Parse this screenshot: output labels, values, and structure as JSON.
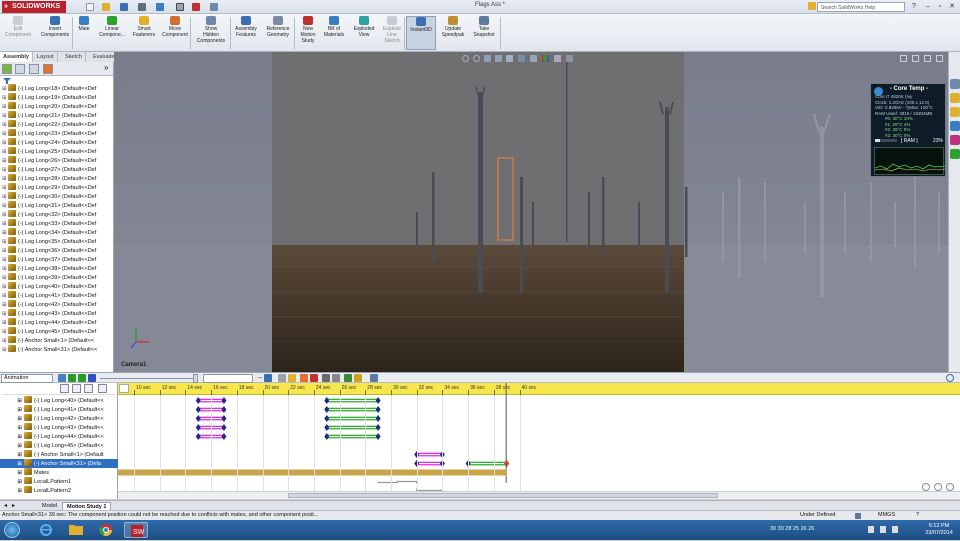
{
  "window": {
    "app_name": "SOLIDWORKS",
    "document_title": "Flags Ass *",
    "help_search_placeholder": "Search SolidWorks Help"
  },
  "ribbon": {
    "items": [
      {
        "label": "Edit\nComponent",
        "disabled": true
      },
      {
        "label": "Insert\nComponents",
        "disabled": false
      },
      {
        "label": "Mate",
        "disabled": false
      },
      {
        "label": "Linear\nCompone...",
        "disabled": false
      },
      {
        "label": "Smart\nFasteners",
        "disabled": false
      },
      {
        "label": "Move\nComponent",
        "disabled": false
      },
      {
        "label": "Show\nHidden\nComponents",
        "disabled": false
      },
      {
        "label": "Assembly\nFeatures",
        "disabled": false
      },
      {
        "label": "Reference\nGeometry",
        "disabled": false
      },
      {
        "label": "New\nMotion\nStudy",
        "disabled": false
      },
      {
        "label": "Bill of\nMaterials",
        "disabled": false
      },
      {
        "label": "Exploded\nView",
        "disabled": false
      },
      {
        "label": "Explode\nLine\nSketch",
        "disabled": true
      },
      {
        "label": "Instant3D",
        "disabled": false
      },
      {
        "label": "Update\nSpeedpak",
        "disabled": false
      },
      {
        "label": "Take\nSnapshot",
        "disabled": false
      }
    ]
  },
  "command_tabs": [
    "Assembly",
    "Layout",
    "Sketch",
    "Evaluate",
    "Render Tools",
    "Office Products"
  ],
  "feature_tree": {
    "rows": [
      "(-) Leg Long<18> (Default<<Def",
      "(-) Leg Long<19> (Default<<Def",
      "(-) Leg Long<20> (Default<<Def",
      "(-) Leg Long<21> (Default<<Def",
      "(-) Leg Long<22> (Default<<Def",
      "(-) Leg Long<23> (Default<<Def",
      "(-) Leg Long<24> (Default<<Def",
      "(-) Leg Long<25> (Default<<Def",
      "(-) Leg Long<26> (Default<<Def",
      "(-) Leg Long<27> (Default<<Def",
      "(-) Leg Long<28> (Default<<Def",
      "(-) Leg Long<29> (Default<<Def",
      "(-) Leg Long<30> (Default<<Def",
      "(-) Leg Long<31> (Default<<Def",
      "(-) Leg Long<32> (Default<<Def",
      "(-) Leg Long<33> (Default<<Def",
      "(-) Leg Long<34> (Default<<Def",
      "(-) Leg Long<35> (Default<<Def",
      "(-) Leg Long<36> (Default<<Def",
      "(-) Leg Long<37> (Default<<Def",
      "(-) Leg Long<38> (Default<<Def",
      "(-) Leg Long<39> (Default<<Def",
      "(-) Leg Long<40> (Default<<Def",
      "(-) Leg Long<41> (Default<<Def",
      "(-) Leg Long<42> (Default<<Def",
      "(-) Leg Long<43> (Default<<Def",
      "(-) Leg Long<44> (Default<<Def",
      "(-) Leg Long<45> (Default<<Def",
      "(-) Anchor Small<1> (Default<<",
      "(-) Anchor Small<31> (Default<<"
    ]
  },
  "viewport": {
    "camera_label": "Camera1"
  },
  "core_temp": {
    "title": "- Core Temp -",
    "lines": [
      "Core i7 4820K (Ivy",
      "Clock: 1.2GHz (100 x 12.0)",
      "VID: 0.8296V - TjMax: 100°C",
      "RAM Used: 3816 / 16304MB",
      "#0: 30°C    10%",
      "#1: 29°C     4%",
      "#2: 28°C     5%",
      "#3: 30°C     0%"
    ],
    "ram_label": "[ RAM ]",
    "ram_percent": "23%"
  },
  "motion": {
    "study_type": "Animation",
    "ruler_labels": [
      "10 sec",
      "12 sec",
      "14 sec",
      "16 sec",
      "18 sec",
      "20 sec",
      "22 sec",
      "24 sec",
      "26 sec",
      "28 sec",
      "30 sec",
      "32 sec",
      "34 sec",
      "36 sec",
      "38 sec",
      "40 sec"
    ],
    "ruler_seconds": [
      10,
      12,
      14,
      16,
      18,
      20,
      22,
      24,
      26,
      28,
      30,
      32,
      34,
      36,
      38,
      40
    ],
    "tree_rows": [
      {
        "label": "(-) Leg Long<40> (Default<<",
        "selected": false
      },
      {
        "label": "(-) Leg Long<41> (Default<<",
        "selected": false
      },
      {
        "label": "(-) Leg Long<42> (Default<<",
        "selected": false
      },
      {
        "label": "(-) Leg Long<43> (Default<<",
        "selected": false
      },
      {
        "label": "(-) Leg Long<44> (Default<<",
        "selected": false
      },
      {
        "label": "(-) Leg Long<45> (Default<<",
        "selected": false
      },
      {
        "label": "(-) Anchor Small<1> (Default",
        "selected": false
      },
      {
        "label": "(-) Anchor Small<31> (Defa",
        "selected": true
      },
      {
        "label": "Mates",
        "selected": false
      },
      {
        "label": "LocalLPattern1",
        "selected": false
      },
      {
        "label": "LocalLPattern2",
        "selected": false
      }
    ],
    "tracks": [
      {
        "row": 0,
        "start": 15,
        "end": 17,
        "color": "#e030e0"
      },
      {
        "row": 1,
        "start": 15,
        "end": 17,
        "color": "#e030e0"
      },
      {
        "row": 2,
        "start": 15,
        "end": 17,
        "color": "#e030e0"
      },
      {
        "row": 3,
        "start": 15,
        "end": 17,
        "color": "#e030e0"
      },
      {
        "row": 4,
        "start": 15,
        "end": 17,
        "color": "#e030e0"
      },
      {
        "row": 0,
        "start": 25,
        "end": 29,
        "color": "#30b030"
      },
      {
        "row": 1,
        "start": 25,
        "end": 29,
        "color": "#30b030"
      },
      {
        "row": 2,
        "start": 25,
        "end": 29,
        "color": "#30b030"
      },
      {
        "row": 3,
        "start": 25,
        "end": 29,
        "color": "#30b030"
      },
      {
        "row": 4,
        "start": 25,
        "end": 29,
        "color": "#30b030"
      },
      {
        "row": 6,
        "start": 32,
        "end": 34,
        "color": "#e030e0"
      },
      {
        "row": 7,
        "start": 32,
        "end": 34,
        "color": "#e030e0"
      },
      {
        "row": 7,
        "start": 36,
        "end": 39,
        "color": "#30b030"
      }
    ]
  },
  "bottom_tabs": [
    "Model",
    "Motion Study 1"
  ],
  "status": {
    "message": "Anchor Small<31> 39 sec: The component position could not be reached due to conflicts with mates, and other component posit...",
    "state": "Under Defined",
    "units": "MMGS"
  },
  "taskbar": {
    "tray_numbers": "30  30  28  25  26  26",
    "time": "6:12 PM",
    "date": "23/07/2014"
  },
  "colors": {
    "ruler": "#f7e74c",
    "keyframe": "#1a2a8a",
    "selection": "#2f6fc2",
    "brand_red": "#b8202a"
  }
}
